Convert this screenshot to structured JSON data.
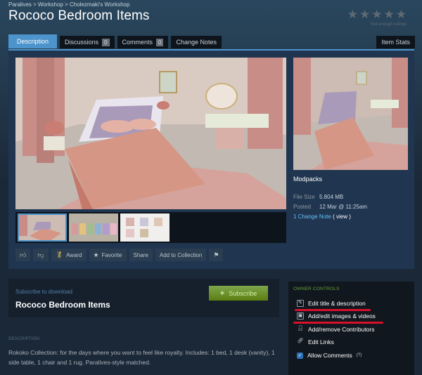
{
  "breadcrumb": {
    "text": "Paralives > Workshop > Cholezmaki's Workshop"
  },
  "title": "Rococo Bedroom Items",
  "rating": {
    "stars": 5,
    "filled": 0,
    "note": "Not enough ratings"
  },
  "tabs": {
    "description": "Description",
    "discussions": "Discussions",
    "discussions_count": "0",
    "comments": "Comments",
    "comments_count": "0",
    "change_notes": "Change Notes",
    "item_stats": "Item Stats"
  },
  "actions": {
    "award": "Award",
    "favorite": "Favorite",
    "share": "Share",
    "add_to_collection": "Add to Collection"
  },
  "details": {
    "modpacks": "Modpacks",
    "file_size_label": "File Size",
    "file_size": "5.804 MB",
    "posted_label": "Posted",
    "posted": "12 Mar @ 11:25am",
    "change_note": "1 Change Note",
    "view_open": "(",
    "view": "view",
    "view_close": ")"
  },
  "subscribe": {
    "label": "Subscribe to download",
    "title": "Rococo Bedroom Items",
    "button": "Subscribe"
  },
  "description": {
    "heading": "DESCRIPTION",
    "body": "Rokoko Collection: for the days where you want to feel like royalty. Includes: 1 bed, 1 desk (vanity), 1 side table, 1 chair and 1 rug. Paralives-style matched."
  },
  "owner": {
    "title": "OWNER CONTROLS",
    "edit_title": "Edit title & description",
    "edit_images": "Add/edit images & videos",
    "contributors": "Add/remove Contributors",
    "edit_links": "Edit Links",
    "allow_comments": "Allow Comments",
    "help": "(?)"
  },
  "colors": {
    "accent": "#4d94cc",
    "subscribe": "#75b022",
    "owner_title": "#69a13c",
    "highlight": "#d8102a"
  }
}
